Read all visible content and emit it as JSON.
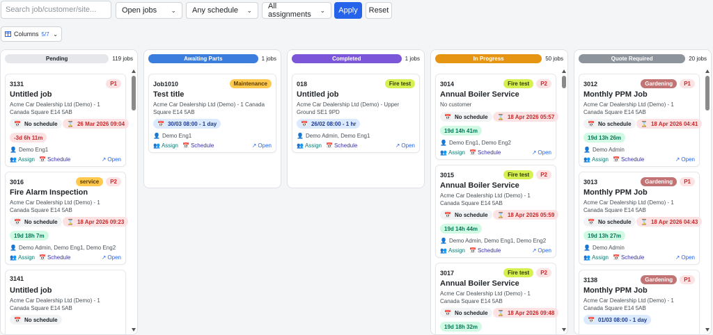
{
  "toolbar": {
    "search_placeholder": "Search job/customer/site...",
    "status_filter": "Open jobs",
    "schedule_filter": "Any schedule",
    "assignment_filter": "All assignments",
    "apply_label": "Apply",
    "reset_label": "Reset"
  },
  "columns_button": {
    "label": "Columns",
    "count": "5/7"
  },
  "columns": [
    {
      "name": "Pending",
      "count": "119 jobs",
      "color": "#e5e7eb",
      "text_color": "#212529"
    },
    {
      "name": "Awaiting Parts",
      "count": "1 jobs",
      "color": "#3b7ddd",
      "text_color": "#ffffff"
    },
    {
      "name": "Completed",
      "count": "1 jobs",
      "color": "#7c56d9",
      "text_color": "#ffffff"
    },
    {
      "name": "In Progress",
      "count": "50 jobs",
      "color": "#e69512",
      "text_color": "#ffffff"
    },
    {
      "name": "Quote Required",
      "count": "20 jobs",
      "color": "#8e949b",
      "text_color": "#ffffff"
    }
  ],
  "cards": {
    "c3131": {
      "id": "3131",
      "priority": "P1",
      "title": "Untitled job",
      "sub": "Acme Car Dealership Ltd (Demo) - 1 Canada Square E14 5AB",
      "no_schedule": "No schedule",
      "due": "26 Mar 2026 09:04",
      "overdue": "-3d 6h 11m",
      "assignees": "Demo Eng1",
      "assign": "Assign",
      "schedule": "Schedule",
      "open": "Open"
    },
    "c3016": {
      "id": "3016",
      "tag": "service",
      "priority": "P2",
      "title": "Fire Alarm Inspection",
      "sub": "Acme Car Dealership Ltd (Demo) - 1 Canada Square E14 5AB",
      "no_schedule": "No schedule",
      "due": "18 Apr 2026 09:23",
      "remain": "19d 18h 7m",
      "assignees": "Demo Admin, Demo Eng1, Demo Eng2",
      "assign": "Assign",
      "schedule": "Schedule",
      "open": "Open"
    },
    "c3141": {
      "id": "3141",
      "title": "Untitled job",
      "sub": "Acme Car Dealership Ltd (Demo) - 1 Canada Square E14 5AB",
      "no_schedule": "No schedule"
    },
    "cjob1010": {
      "id": "Job1010",
      "tag": "Maintenance",
      "title": "Test title",
      "sub": "Acme Car Dealership Ltd (Demo) - 1 Canada Square E14 5AB",
      "sched": "30/03 08:00 - 1 day",
      "assignees": "Demo Eng1",
      "assign": "Assign",
      "schedule": "Schedule",
      "open": "Open"
    },
    "c018": {
      "id": "018",
      "tag": "Fire test",
      "title": "Untitled job",
      "sub": "Acme Car Dealership Ltd (Demo) - Upper Ground SE1 9PD",
      "sched": "26/02 08:00 - 1 hr",
      "assignees": "Demo Admin, Demo Eng1",
      "assign": "Assign",
      "schedule": "Schedule",
      "open": "Open"
    },
    "c3014": {
      "id": "3014",
      "tag": "Fire test",
      "priority": "P2",
      "title": "Annual Boiler Service",
      "sub": "No customer",
      "no_schedule": "No schedule",
      "due": "18 Apr 2026 05:57",
      "remain": "19d 14h 41m",
      "assignees": "Demo Eng1, Demo Eng2",
      "assign": "Assign",
      "schedule": "Schedule",
      "open": "Open"
    },
    "c3015": {
      "id": "3015",
      "tag": "Fire test",
      "priority": "P2",
      "title": "Annual Boiler Service",
      "sub": "Acme Car Dealership Ltd (Demo) - 1 Canada Square E14 5AB",
      "no_schedule": "No schedule",
      "due": "18 Apr 2026 05:59",
      "remain": "19d 14h 44m",
      "assignees": "Demo Admin, Demo Eng1, Demo Eng2",
      "assign": "Assign",
      "schedule": "Schedule",
      "open": "Open"
    },
    "c3017": {
      "id": "3017",
      "tag": "Fire test",
      "priority": "P2",
      "title": "Annual Boiler Service",
      "sub": "Acme Car Dealership Ltd (Demo) - 1 Canada Square E14 5AB",
      "no_schedule": "No schedule",
      "due": "18 Apr 2026 09:48",
      "remain": "19d 18h 32m"
    },
    "c3012": {
      "id": "3012",
      "tag": "Gardening",
      "priority": "P1",
      "title": "Monthly PPM Job",
      "sub": "Acme Car Dealership Ltd (Demo) - 1 Canada Square E14 5AB",
      "no_schedule": "No schedule",
      "due": "18 Apr 2026 04:41",
      "remain": "19d 13h 26m",
      "assignees": "Demo Admin",
      "assign": "Assign",
      "schedule": "Schedule",
      "open": "Open"
    },
    "c3013": {
      "id": "3013",
      "tag": "Gardening",
      "priority": "P1",
      "title": "Monthly PPM Job",
      "sub": "Acme Car Dealership Ltd (Demo) - 1 Canada Square E14 5AB",
      "no_schedule": "No schedule",
      "due": "18 Apr 2026 04:43",
      "remain": "19d 13h 27m",
      "assignees": "Demo Admin",
      "assign": "Assign",
      "schedule": "Schedule",
      "open": "Open"
    },
    "c3138": {
      "id": "3138",
      "tag": "Gardening",
      "priority": "P1",
      "title": "Monthly PPM Job",
      "sub": "Acme Car Dealership Ltd (Demo) - 1 Canada Square E14 5AB",
      "sched": "01/03 08:00 - 1 day"
    }
  }
}
